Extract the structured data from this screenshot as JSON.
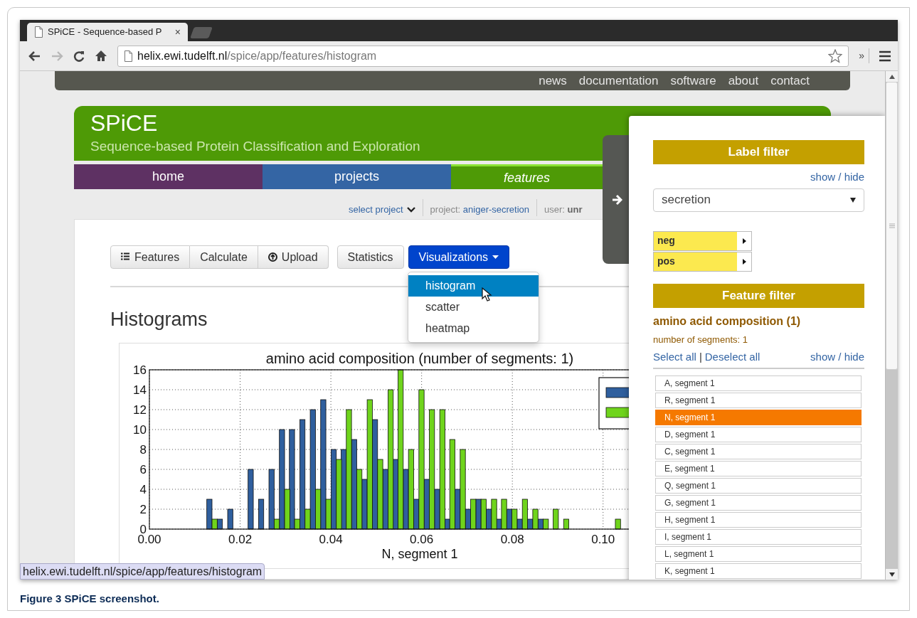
{
  "browser": {
    "tab_title": "SPiCE - Sequence-based P",
    "tab_close": "×",
    "url_host": "helix.ewi.tudelft.nl",
    "url_path": "/spice/app/features/histogram",
    "overflow": "»"
  },
  "top_links": [
    "news",
    "documentation",
    "software",
    "about",
    "contact"
  ],
  "header": {
    "title": "SPiCE",
    "subtitle": "Sequence-based Protein Classification and Exploration"
  },
  "nav_tabs": [
    {
      "label": "home",
      "selected": false,
      "color": "#5e3163"
    },
    {
      "label": "projects",
      "selected": false,
      "color": "#3465a4"
    },
    {
      "label": "features",
      "selected": true,
      "color": "#4e9a06"
    }
  ],
  "subbar": {
    "select_project": "select project",
    "project_label": "project:",
    "project_name": "aniger-secretion",
    "user_label": "user:",
    "user_name": "unr"
  },
  "toolbar": [
    [
      {
        "label": "Features",
        "kind": "list"
      },
      {
        "label": "Calculate",
        "kind": "plain"
      },
      {
        "label": "Upload",
        "kind": "upload"
      }
    ],
    [
      {
        "label": "Statistics"
      }
    ],
    [
      {
        "label": "Visualizations",
        "open": true
      }
    ]
  ],
  "menu": [
    {
      "label": "histogram",
      "selected": true
    },
    {
      "label": "scatter",
      "selected": false
    },
    {
      "label": "heatmap",
      "selected": false
    }
  ],
  "heading": "Histograms",
  "chart_data": {
    "type": "bar",
    "title": "amino acid composition (number of segments: 1)",
    "xlabel": "N, segment 1",
    "x": [
      0.0138,
      0.0161,
      0.0184,
      0.0229,
      0.0252,
      0.0275,
      0.0298,
      0.032,
      0.0343,
      0.0366,
      0.0389,
      0.0412,
      0.0434,
      0.0457,
      0.048,
      0.0503,
      0.0526,
      0.0548,
      0.0571,
      0.0594,
      0.0617,
      0.064,
      0.0662,
      0.0685,
      0.0708,
      0.0731,
      0.0754,
      0.0776,
      0.0799,
      0.0822,
      0.0845,
      0.0868,
      0.089,
      0.0913,
      0.1027
    ],
    "series": [
      {
        "color": "#2f5f9e",
        "values": [
          3,
          1,
          2,
          6,
          3,
          6,
          10,
          10,
          11,
          12,
          13,
          8,
          8,
          9,
          5,
          11,
          6,
          7,
          6,
          3,
          5,
          4,
          1,
          4,
          2,
          3,
          2,
          1,
          2,
          1,
          1,
          1,
          0,
          0,
          0
        ]
      },
      {
        "color": "#6fd41c",
        "values": [
          1,
          0,
          0,
          0,
          0,
          1,
          4,
          1,
          2,
          4,
          3,
          7,
          12,
          6,
          13,
          7,
          14,
          16,
          8,
          14,
          12,
          12,
          9,
          8,
          3,
          3,
          3,
          3,
          2,
          3,
          2,
          1,
          2,
          1,
          1
        ]
      }
    ],
    "grid": true,
    "xlim": [
      0,
      0.106
    ],
    "ylim": [
      0,
      16
    ],
    "xticks": [
      {
        "value": 0,
        "label": "0.00"
      },
      {
        "value": 0.02,
        "label": "0.02"
      },
      {
        "value": 0.04,
        "label": "0.04"
      },
      {
        "value": 0.06,
        "label": "0.06"
      },
      {
        "value": 0.08,
        "label": "0.08"
      },
      {
        "value": 0.1,
        "label": "0.10"
      }
    ],
    "yticks": [
      0,
      2,
      4,
      6,
      8,
      10,
      12,
      14,
      16
    ]
  },
  "status_url": "helix.ewi.tudelft.nl/spice/app/features/histogram",
  "panel": {
    "label_filter": {
      "title": "Label filter",
      "toggle": "show / hide",
      "select": "secretion",
      "labels": [
        {
          "label": "neg"
        },
        {
          "label": "pos"
        }
      ]
    },
    "feature_filter": {
      "title": "Feature filter",
      "group": "amino acid composition (1)",
      "note": "number of segments: 1",
      "select_all": "Select all",
      "separator": "|",
      "deselect_all": "Deselect all",
      "toggle": "show / hide",
      "items": [
        {
          "label": "A, segment 1",
          "selected": false
        },
        {
          "label": "R, segment 1",
          "selected": false
        },
        {
          "label": "N, segment 1",
          "selected": true
        },
        {
          "label": "D, segment 1",
          "selected": false
        },
        {
          "label": "C, segment 1",
          "selected": false
        },
        {
          "label": "E, segment 1",
          "selected": false
        },
        {
          "label": "Q, segment 1",
          "selected": false
        },
        {
          "label": "G, segment 1",
          "selected": false
        },
        {
          "label": "H, segment 1",
          "selected": false
        },
        {
          "label": "I, segment 1",
          "selected": false
        },
        {
          "label": "L, segment 1",
          "selected": false
        },
        {
          "label": "K, segment 1",
          "selected": false
        }
      ]
    }
  },
  "caption": "Figure 3 SPiCE screenshot."
}
